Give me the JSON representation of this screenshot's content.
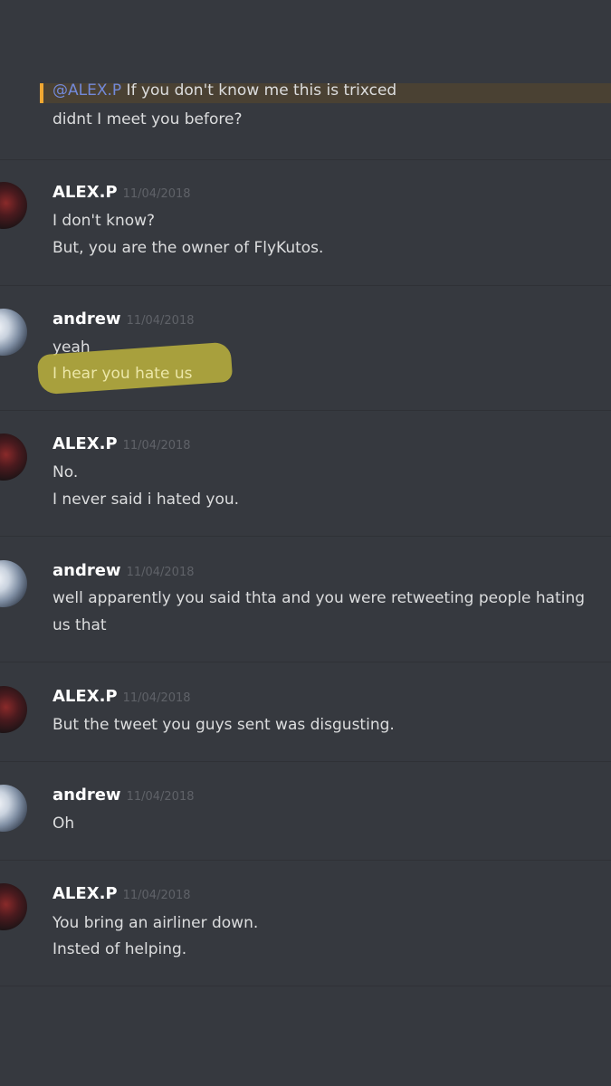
{
  "top_message": {
    "mention": "@ALEX.P",
    "mention_rest": " If you don't know me this is trixced",
    "line": "didnt I meet you before?"
  },
  "messages": [
    {
      "username": "ALEX.P",
      "timestamp": "11/04/2018",
      "lines": [
        "I don't know?",
        "But, you are the owner of FlyKutos."
      ]
    },
    {
      "username": "andrew",
      "timestamp": "11/04/2018",
      "lines": [
        "yeah",
        "I hear you hate us"
      ]
    },
    {
      "username": "ALEX.P",
      "timestamp": "11/04/2018",
      "lines": [
        "No.",
        "I never said i hated you."
      ]
    },
    {
      "username": "andrew",
      "timestamp": "11/04/2018",
      "lines": [
        "well apparently you said thta and you were retweeting people hating us that"
      ]
    },
    {
      "username": "ALEX.P",
      "timestamp": "11/04/2018",
      "lines": [
        "But the tweet you guys sent was disgusting."
      ]
    },
    {
      "username": "andrew",
      "timestamp": "11/04/2018",
      "lines": [
        "Oh"
      ]
    },
    {
      "username": "ALEX.P",
      "timestamp": "11/04/2018",
      "lines": [
        "You bring an airliner down.",
        "Insted of helping."
      ]
    }
  ],
  "colors": {
    "background": "#36393f",
    "mention": "#7289da",
    "mention_bar": "#f0a732",
    "highlighter": "#c8be3c"
  }
}
